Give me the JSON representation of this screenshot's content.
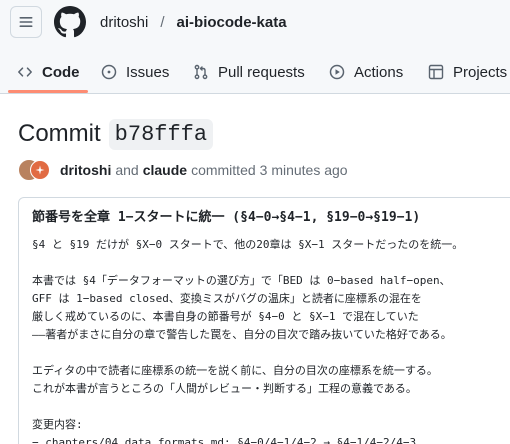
{
  "header": {
    "owner": "dritoshi",
    "separator": "/",
    "repo": "ai-biocode-kata",
    "tabs": [
      {
        "label": "Code",
        "icon": "code-icon",
        "active": true
      },
      {
        "label": "Issues",
        "icon": "issue-opened-icon",
        "active": false
      },
      {
        "label": "Pull requests",
        "icon": "git-pull-request-icon",
        "active": false
      },
      {
        "label": "Actions",
        "icon": "play-icon",
        "active": false
      },
      {
        "label": "Projects",
        "icon": "table-icon",
        "active": false
      }
    ],
    "active_tab_color": "#fd8c73"
  },
  "commit": {
    "heading": "Commit",
    "sha": "b78fffa",
    "author": "dritoshi",
    "conjunction": "and",
    "coauthor": "claude",
    "verb": "committed",
    "time": "3 minutes ago"
  },
  "message": {
    "title": "節番号を全章 1−スタートに統一 (§4−0→§4−1, §19−0→§19−1)",
    "lines": [
      "§4 と §19 だけが §X−0 スタートで、他の20章は §X−1 スタートだったのを統一。",
      "",
      "本書では §4「データフォーマットの選び方」で「BED は 0−based half−open、",
      "GFF は 1−based closed、変換ミスがバグの温床」と読者に座標系の混在を",
      "厳しく戒めているのに、本書自身の節番号が §4−0 と §X−1 で混在していた",
      "——著者がまさに自分の章で警告した罠を、自分の目次で踏み抜いていた格好である。",
      "",
      "エディタの中で読者に座標系の統一を説く前に、自分の目次の座標系を統一する。",
      "これが本書が言うところの「人間がレビュー・判断する」工程の意義である。",
      "",
      "変更内容:",
      "− chapters/04_data_formats.md: §4−0/4−1/4−2 → §4−1/4−2/4−3"
    ]
  }
}
